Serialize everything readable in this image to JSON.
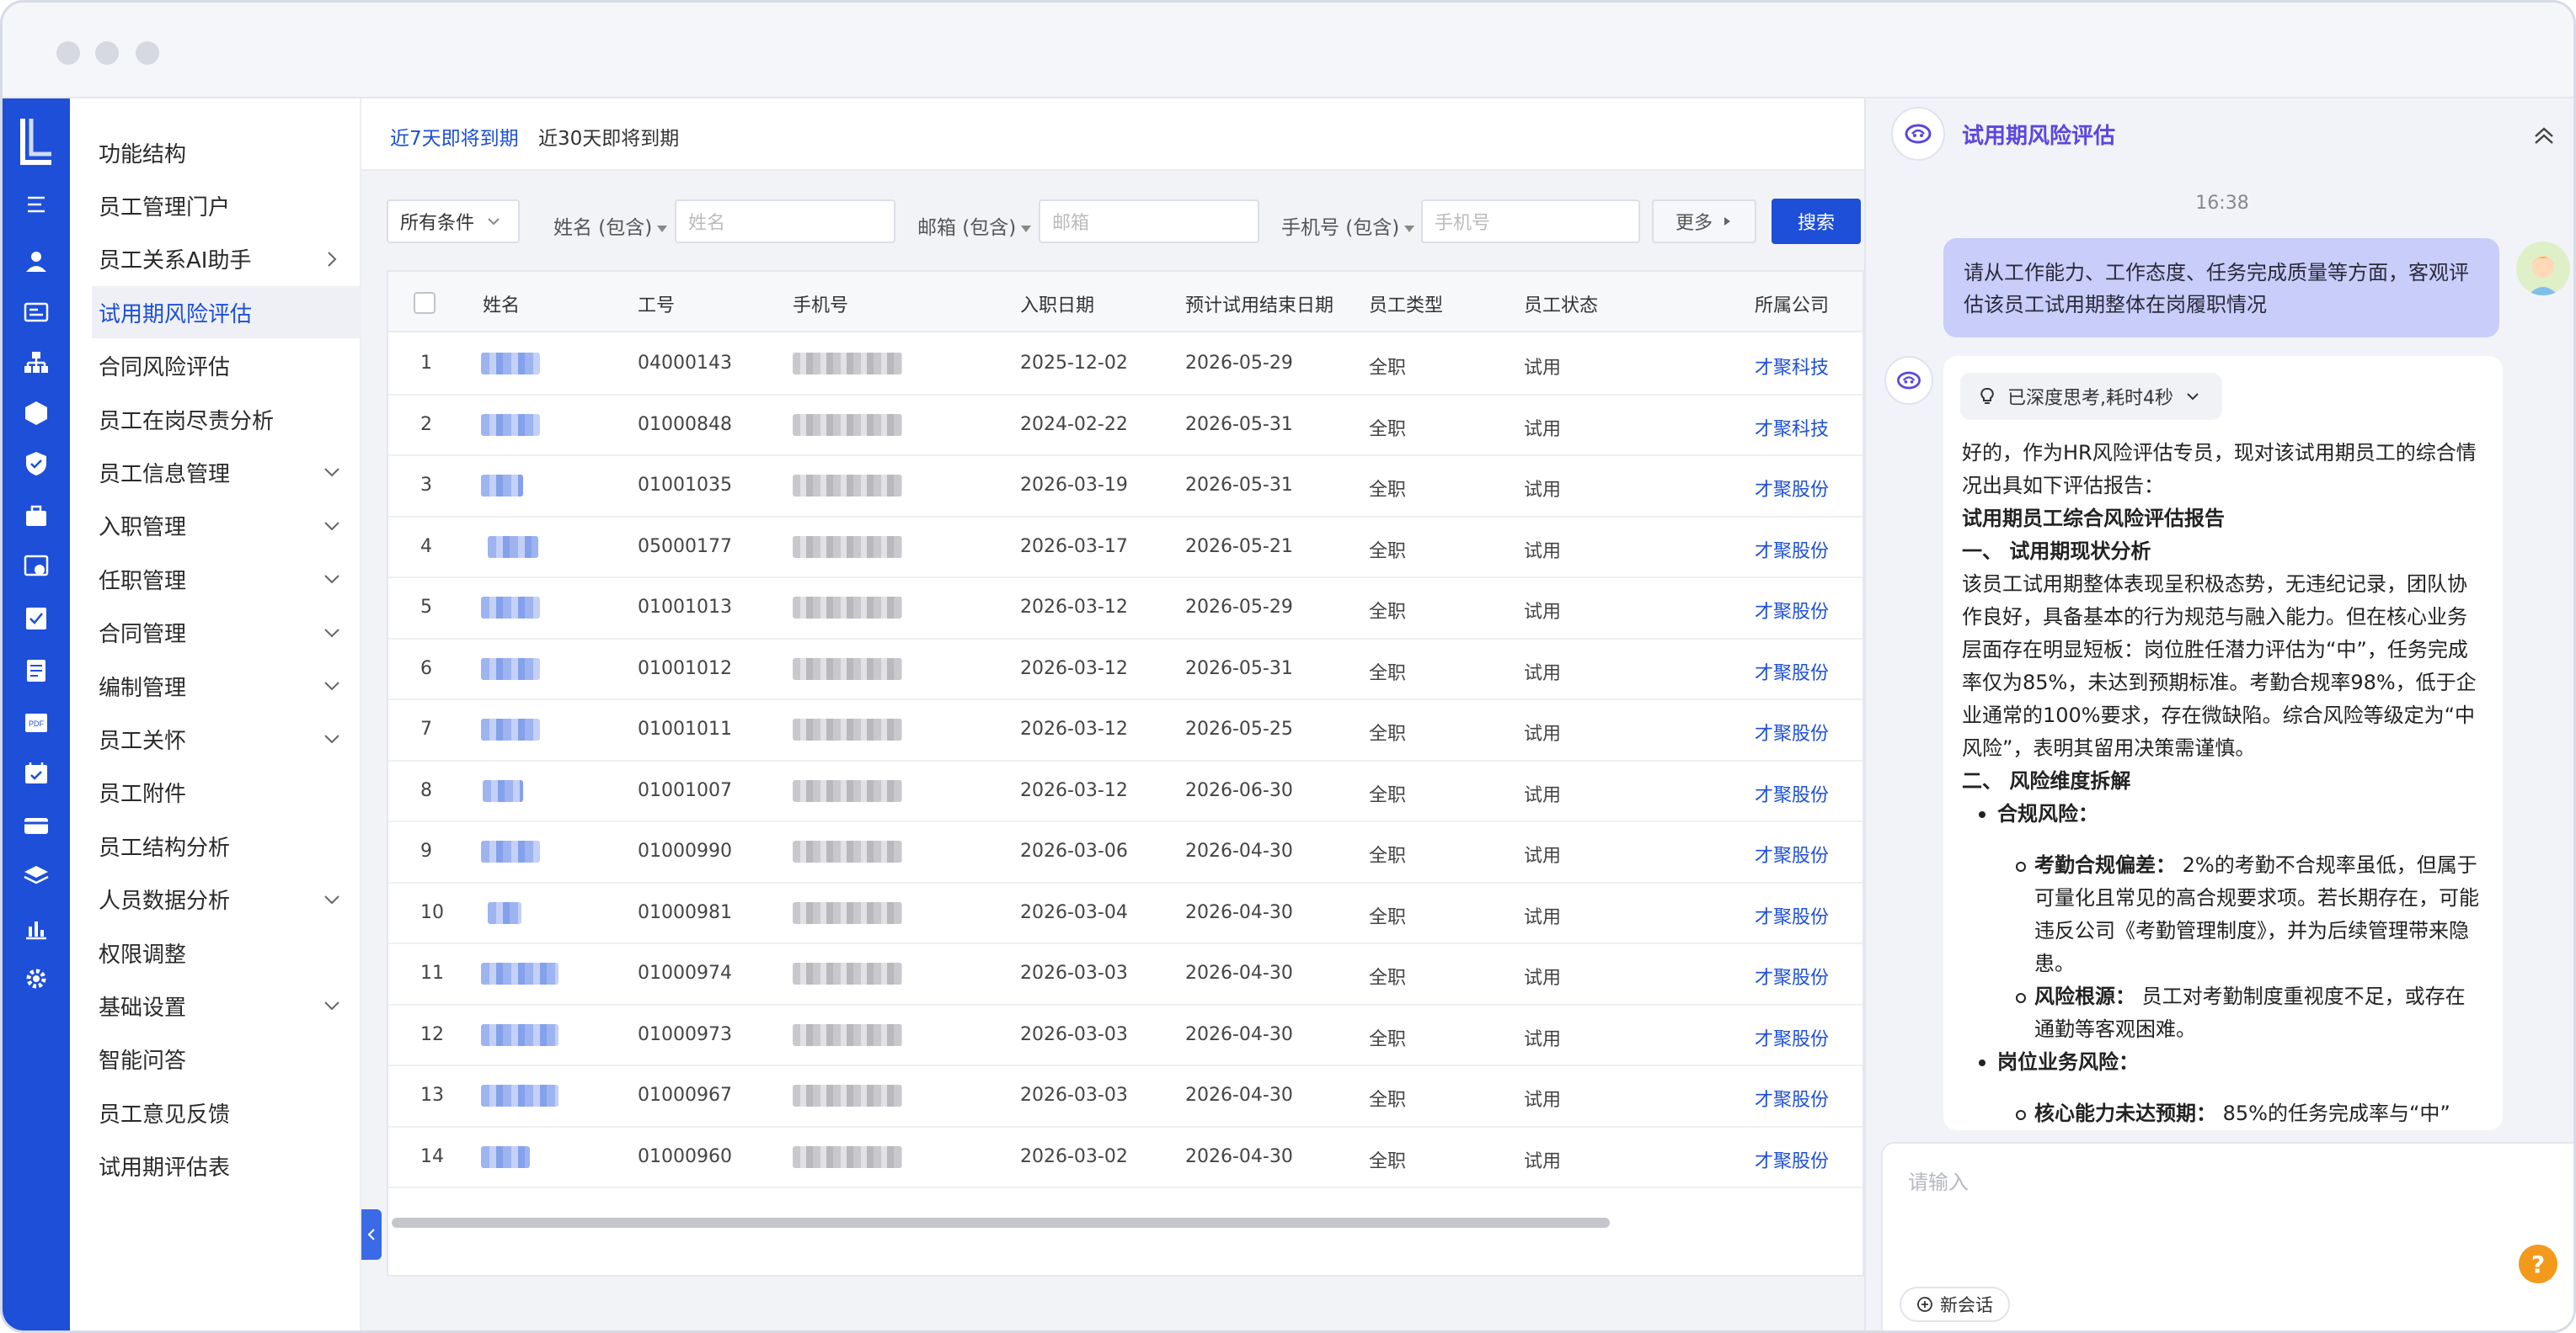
{
  "sidebar": {
    "items": [
      {
        "label": "功能结构",
        "chevron": ""
      },
      {
        "label": "员工管理门户",
        "chevron": ""
      },
      {
        "label": "员工关系AI助手",
        "chevron": "right"
      },
      {
        "label": "试用期风险评估",
        "chevron": "",
        "active": true
      },
      {
        "label": "合同风险评估",
        "chevron": ""
      },
      {
        "label": "员工在岗尽责分析",
        "chevron": ""
      },
      {
        "label": "员工信息管理",
        "chevron": "down"
      },
      {
        "label": "入职管理",
        "chevron": "down"
      },
      {
        "label": "任职管理",
        "chevron": "down"
      },
      {
        "label": "合同管理",
        "chevron": "down"
      },
      {
        "label": "编制管理",
        "chevron": "down"
      },
      {
        "label": "员工关怀",
        "chevron": "down"
      },
      {
        "label": "员工附件",
        "chevron": ""
      },
      {
        "label": "员工结构分析",
        "chevron": ""
      },
      {
        "label": "人员数据分析",
        "chevron": "down"
      },
      {
        "label": "权限调整",
        "chevron": ""
      },
      {
        "label": "基础设置",
        "chevron": "down"
      },
      {
        "label": "智能问答",
        "chevron": ""
      },
      {
        "label": "员工意见反馈",
        "chevron": ""
      },
      {
        "label": "试用期评估表",
        "chevron": ""
      }
    ]
  },
  "rail_icons": [
    "collapse-icon",
    "user-icon",
    "id-card-icon",
    "org-icon",
    "cube-icon",
    "shield-icon",
    "briefcase-icon",
    "settings-box-icon",
    "checklist-icon",
    "document-icon",
    "pdf-icon",
    "calendar-icon",
    "card-icon",
    "layers-icon",
    "chart-icon",
    "gear-icon"
  ],
  "tabs": {
    "t7": "近7天即将到期",
    "t30": "近30天即将到期"
  },
  "filters": {
    "condition": "所有条件",
    "name_label": "姓名 (包含)",
    "name_placeholder": "姓名",
    "email_label": "邮箱 (包含)",
    "email_placeholder": "邮箱",
    "phone_label": "手机号 (包含)",
    "phone_placeholder": "手机号",
    "more": "更多",
    "search": "搜索"
  },
  "table": {
    "headers": [
      "姓名",
      "工号",
      "手机号",
      "入职日期",
      "预计试用结束日期",
      "员工类型",
      "员工状态",
      "所属公司"
    ],
    "rows": [
      {
        "no": "1",
        "id": "04000143",
        "hire": "2025-12-02",
        "end": "2026-05-29",
        "type": "全职",
        "status": "试用",
        "company": "才聚科技"
      },
      {
        "no": "2",
        "id": "01000848",
        "hire": "2024-02-22",
        "end": "2026-05-31",
        "type": "全职",
        "status": "试用",
        "company": "才聚科技"
      },
      {
        "no": "3",
        "id": "01001035",
        "hire": "2026-03-19",
        "end": "2026-05-31",
        "type": "全职",
        "status": "试用",
        "company": "才聚股份"
      },
      {
        "no": "4",
        "id": "05000177",
        "hire": "2026-03-17",
        "end": "2026-05-21",
        "type": "全职",
        "status": "试用",
        "company": "才聚股份"
      },
      {
        "no": "5",
        "id": "01001013",
        "hire": "2026-03-12",
        "end": "2026-05-29",
        "type": "全职",
        "status": "试用",
        "company": "才聚股份"
      },
      {
        "no": "6",
        "id": "01001012",
        "hire": "2026-03-12",
        "end": "2026-05-31",
        "type": "全职",
        "status": "试用",
        "company": "才聚股份"
      },
      {
        "no": "7",
        "id": "01001011",
        "hire": "2026-03-12",
        "end": "2026-05-25",
        "type": "全职",
        "status": "试用",
        "company": "才聚股份"
      },
      {
        "no": "8",
        "id": "01001007",
        "hire": "2026-03-12",
        "end": "2026-06-30",
        "type": "全职",
        "status": "试用",
        "company": "才聚股份"
      },
      {
        "no": "9",
        "id": "01000990",
        "hire": "2026-03-06",
        "end": "2026-04-30",
        "type": "全职",
        "status": "试用",
        "company": "才聚股份"
      },
      {
        "no": "10",
        "id": "01000981",
        "hire": "2026-03-04",
        "end": "2026-04-30",
        "type": "全职",
        "status": "试用",
        "company": "才聚股份"
      },
      {
        "no": "11",
        "id": "01000974",
        "hire": "2026-03-03",
        "end": "2026-04-30",
        "type": "全职",
        "status": "试用",
        "company": "才聚股份"
      },
      {
        "no": "12",
        "id": "01000973",
        "hire": "2026-03-03",
        "end": "2026-04-30",
        "type": "全职",
        "status": "试用",
        "company": "才聚股份"
      },
      {
        "no": "13",
        "id": "01000967",
        "hire": "2026-03-03",
        "end": "2026-04-30",
        "type": "全职",
        "status": "试用",
        "company": "才聚股份"
      },
      {
        "no": "14",
        "id": "01000960",
        "hire": "2026-03-02",
        "end": "2026-04-30",
        "type": "全职",
        "status": "试用",
        "company": "才聚股份"
      }
    ]
  },
  "chat": {
    "title": "试用期风险评估",
    "time": "16:38",
    "user_message": "请从工作能力、工作态度、任务完成质量等方面，客观评估该员工试用期整体在岗履职情况",
    "think_label": "已深度思考,耗时4秒",
    "intro": "好的，作为HR风险评估专员，现对该试用期员工的综合情况出具如下评估报告：",
    "report_title": "试用期员工综合风险评估报告",
    "sec1_title": "一、 试用期现状分析",
    "sec1_body": "该员工试用期整体表现呈积极态势，无违纪记录，团队协作良好，具备基本的行为规范与融入能力。但在核心业务层面存在明显短板：岗位胜任潜力评估为“中”，任务完成率仅为85%，未达到预期标准。考勤合规率98%，低于企业通常的100%要求，存在微缺陷。综合风险等级定为“中风险”，表明其留用决策需谨慎。",
    "sec2_title": "二、 风险维度拆解",
    "b1": "合规风险：",
    "b1a_label": "考勤合规偏差：",
    "b1a_text": "2%的考勤不合规率虽低，但属于可量化且常见的高合规要求项。若长期存在，可能违反公司《考勤管理制度》，并为后续管理带来隐患。",
    "b1b_label": "风险根源：",
    "b1b_text": "员工对考勤制度重视度不足，或存在通勤等客观困难。",
    "b2": "岗位业务风险：",
    "b2a_label": "核心能力未达预期：",
    "b2a_text": "85%的任务完成率与“中”",
    "input_placeholder": "请输入",
    "new_session": "新会话",
    "help": "?"
  },
  "colors": {
    "brand": "#1d4fd8",
    "chat_title": "#5b46e0",
    "help": "#f39a1c"
  }
}
